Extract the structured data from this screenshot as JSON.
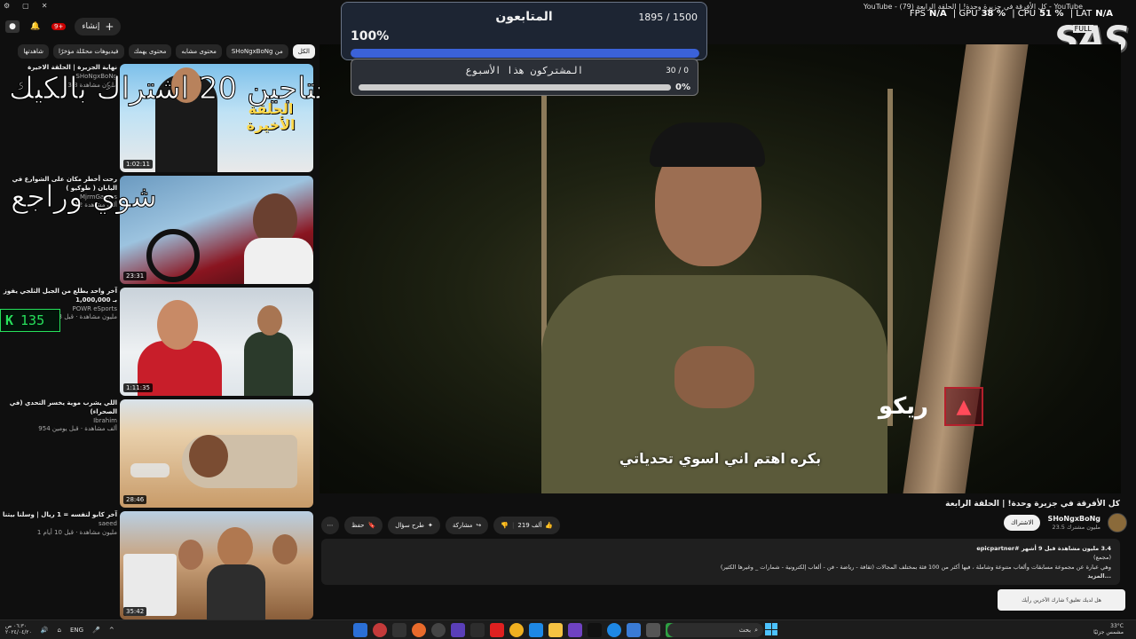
{
  "window": {
    "title": "YouTube - كل الأفرقة في جزيرة وحدة! | الحلقة الرابعة (79) - YouTube",
    "controls": [
      "⚙",
      "▢",
      "✕"
    ]
  },
  "overlay_stats": {
    "fps_label": "FPS",
    "fps": "N/A",
    "gpu_label": "GPU",
    "gpu": "38 %",
    "cpu_label": "CPU",
    "cpu": "51 %",
    "lat_label": "LAT",
    "lat": "N/A",
    "logo": "SAS",
    "logo_tag": "FULL"
  },
  "header": {
    "create_label": "إنشاء",
    "create_icon": "+",
    "notif_badge": "9+"
  },
  "chips": [
    "الكل",
    "من SHoNgxBoNg",
    "محتوى مشابه",
    "محتوى يهمك",
    "فيديوهات محمّلة مؤخرًا",
    "شاهدتها"
  ],
  "overlay_text": {
    "line1": "محتاجين 20 اشتراك بالكيك",
    "line2": "شوي وراجع",
    "counter": "135",
    "counter_icon": "K"
  },
  "followers_widget": {
    "label": "المتابعون",
    "count": "1895 / 1500",
    "percent": "100%",
    "progress": 1.0
  },
  "subs_widget": {
    "label": "المشتركون هذا الأسبوع",
    "count": "30 / 0",
    "percent": "0%",
    "progress": 0.0
  },
  "sidebar_videos": [
    {
      "title": "نهاية الجزيرة | الحلقة الاخيرة",
      "channel": "SHoNgxBoNg",
      "meta": "3.3 مليون مشاهدة",
      "duration": "1:02:11",
      "colors": [
        "#4ea3d8",
        "#f2f2f2"
      ],
      "overlay_title": "الحلقة الأخيرة"
    },
    {
      "title": "رحت أخطر مكان على الشوارع في اليابان ( طوكيو )",
      "channel": "MjrmGames",
      "meta": "12 ألف مشاهدة",
      "duration": "23:31",
      "colors": [
        "#7aa7c7",
        "#a3202a"
      ],
      "overlay_title": ""
    },
    {
      "title": "آخر واحد يطلع من الجبل الثلجي يفوز بـ 1,000,000",
      "channel": "POWR eSports",
      "meta": "4.9 مليون مشاهدة · قبل 3 أشهر",
      "duration": "1:11:35",
      "colors": [
        "#d9dde2",
        "#c81e2a"
      ],
      "overlay_title": ""
    },
    {
      "title": "اللي يشرب موية يخسر التحدي (في الصحراء)",
      "channel": "Ibrahim",
      "meta": "954 ألف مشاهدة · قبل يومين",
      "duration": "28:46",
      "colors": [
        "#e7c9a1",
        "#b58657"
      ],
      "overlay_title": ""
    },
    {
      "title": "آخر كابو لنفسه = 1 ريال | وسلنا بيتنا",
      "channel": "saeed",
      "meta": "1 مليون مشاهدة · قبل 10 أيام",
      "duration": "35:42",
      "colors": [
        "#c9d7e6",
        "#9b6b3f"
      ],
      "overlay_title": ""
    }
  ],
  "player": {
    "caption": "بكره اهتم اني اسوي تحدياتي",
    "name_tag": "ريكو",
    "name_logo": "▲"
  },
  "video": {
    "title": "كل الأفرقة في جزيرة وحدة! | الحلقة الرابعة",
    "channel": "SHoNgxBoNg",
    "channel_subs": "23.5 مليون مشترك",
    "subscribe_label": "الاشتراك",
    "likes": "219 ألف",
    "share_label": "مشاركة",
    "ask_label": "طرح سؤال",
    "save_label": "حفظ",
    "more_icon": "⋯",
    "views_line": "3.4 مليون مشاهدة قبل 9 أشهر #epicpartner",
    "desc_line1": "(مجمع)",
    "desc_line2": "وهي عبارة عن مجموعة مسابقات وألعاب متنوعة وشاملة ، فيها أكثر من 100 فئة بمختلف المجالات (ثقافة - رياضة - فن - ألعاب إلكترونية - شمارات _ وغيرها الكثير)",
    "desc_more": "...المزيد",
    "comment_prompt": "هل لديك تعليق؟ شارك الآخرين رأيك"
  },
  "taskbar": {
    "time": "٠٦:٣٠ ص",
    "date": "٢٠٢٤/٠٤/٢٠",
    "lang": "ENG",
    "search_placeholder": "بحث",
    "weather_temp": "33°C",
    "weather_desc": "مشمس جزئيًا"
  }
}
